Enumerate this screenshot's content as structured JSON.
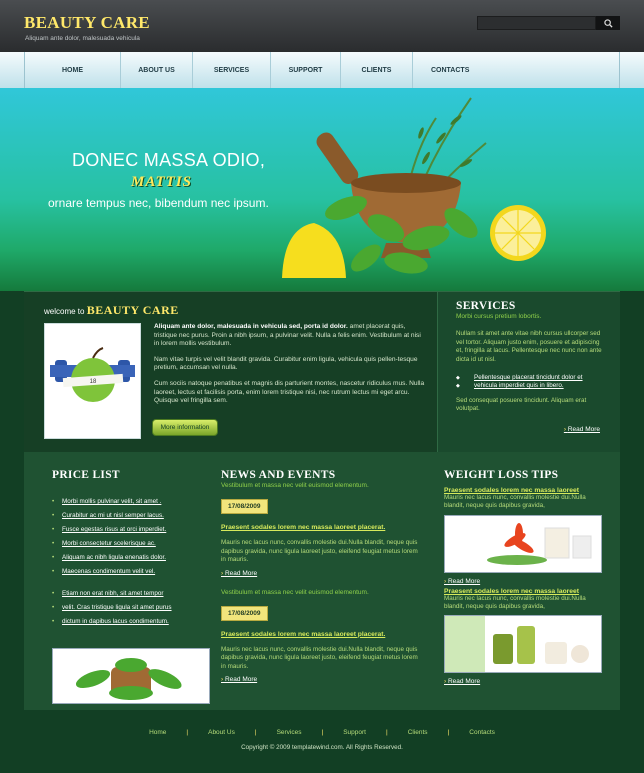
{
  "header": {
    "logo": "BEAUTY CARE",
    "tagline": "Aliquam ante dolor, malesuada vehicula",
    "search_placeholder": ""
  },
  "nav": [
    "HOME",
    "ABOUT US",
    "SERVICES",
    "SUPPORT",
    "CLIENTS",
    "CONTACTS"
  ],
  "hero": {
    "line1": "DONEC MASSA ODIO,",
    "line2": "MATTIS",
    "line3": "ornare tempus nec, bibendum nec ipsum."
  },
  "welcome": {
    "prefix": "welcome to",
    "brand": "BEAUTY CARE",
    "lead_bold": "Aliquam ante dolor, malesuada in vehicula sed, porta id dolor.",
    "lead_rest": " amet placerat quis, tristique nec purus. Proin a nibh ipsum, a pulvinar velit. Nulla a felis enim. Vestibulum at nisi in lorem mollis vestibulum.",
    "p2": "Nam vitae turpis vel velit blandit gravida. Curabitur enim ligula, vehicula quis pellen-tesque pretium, accumsan vel nulla.",
    "p3": "Cum sociis natoque penatibus et magnis dis parturient montes, nascetur ridiculus mus. Nulla laoreet, lectus et facilisis porta, enim lorem tristique nisi, nec rutrum lectus mi eget arcu. Quisque vel fringilla sem.",
    "apple_label": "18",
    "more_button": "More information"
  },
  "services": {
    "title": "SERVICES",
    "subtitle": "Morbi cursus pretium lobortis.",
    "text": "Nullam sit amet ante vitae nibh cursus ullcorper sed vel tortor. Aliquam justo enim, posuere et adipiscing et, fringilla at lacus. Pellentesque nec nunc non ante dicta id ut nisl.",
    "links": [
      "Pellentesque placerat tincidunt dolor et",
      "vehicula imperdiet quis in libero."
    ],
    "text2": "Sed consequat posuere tincidunt. Aliquam erat volutpat.",
    "read_more": "Read More"
  },
  "price_list": {
    "title": "PRICE LIST",
    "group1": [
      "Morbi mollis pulvinar velit, sit amet .",
      "Curabitur ac mi ut nisl semper lacus.",
      "Fusce egestas risus at orci imperdiet.",
      "Morbi consectetur scelerisque ac.",
      "Aliquam ac nibh ligula enenatis dolor.",
      "Maecenas condimentum velit vel."
    ],
    "group2": [
      "Etiam non erat nibh, sit amet tempor",
      "velit. Cras tristique ligula sit amet purus",
      "dictum in dapibus lacus condimentum."
    ]
  },
  "news": {
    "title": "NEWS AND EVENTS",
    "subtitle": "Vestibulum et massa nec velit euismod elementum.",
    "items": [
      {
        "date": "17/08/2009",
        "title": "Praesent sodales lorem nec massa laoreet placerat.",
        "body": "Mauris nec lacus nunc, convallis molestie dui.Nulla blandit, neque quis dapibus gravida, nunc ligula laoreet justo, eleifend feugiat metus lorem in mauris.",
        "read_more": "Read More"
      },
      {
        "pre": "Vestibulum et massa nec velit euismod elementum.",
        "date": "17/08/2009",
        "title": "Praesent sodales lorem nec massa laoreet placerat.",
        "body": "Mauris nec lacus nunc, convallis molestie dui.Nulla blandit, neque quis dapibus gravida, nunc ligula laoreet justo, eleifend feugiat metus lorem in mauris.",
        "read_more": "Read More"
      }
    ]
  },
  "weight": {
    "title": "WEIGHT LOSS TIPS",
    "items": [
      {
        "title": "Praesent sodales lorem nec massa laoreet",
        "body": "Mauris nec lacus nunc, convallis molestie dui.Nulla blandit, neque quis dapibus gravida,",
        "read_more": "Read More"
      },
      {
        "title": "Praesent sodales lorem nec massa laoreet",
        "body": "Mauris nec lacus nunc, convallis molestie dui.Nulla blandit, neque quis dapibus gravida,",
        "read_more": "Read More"
      }
    ]
  },
  "footer": {
    "links": [
      "Home",
      "About Us",
      "Services",
      "Support",
      "Clients",
      "Contacts"
    ],
    "copyright": "Copyright © 2009 templatewind.com. All Rights Reserved."
  },
  "colors": {
    "accent": "#ffe86a",
    "dark_green": "#123f24",
    "lime": "#b6dc7a"
  }
}
